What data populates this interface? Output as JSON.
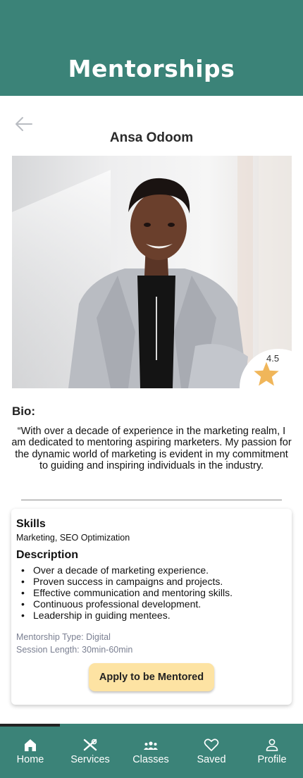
{
  "header": {
    "title": "Mentorships"
  },
  "mentor": {
    "name": "Ansa Odoom",
    "rating": "4.5"
  },
  "bio": {
    "title": "Bio:",
    "text": "“With over a decade of experience in the marketing realm, I am dedicated to mentoring aspiring marketers. My passion for the dynamic world of marketing is evident in my commitment to guiding and inspiring individuals in the industry."
  },
  "skills": {
    "title": "Skills",
    "text": "Marketing, SEO Optimization"
  },
  "description": {
    "title": "Description",
    "items": [
      "Over a decade of marketing experience.",
      "Proven success in campaigns and projects.",
      "Effective communication and mentoring skills.",
      "Continuous professional development.",
      "Leadership in guiding mentees."
    ]
  },
  "meta": {
    "type": "Mentorship Type: Digital",
    "length": "Session Length: 30min-60min"
  },
  "apply_button": "Apply to be Mentored",
  "nav": {
    "active": "Home",
    "items": [
      {
        "label": "Home",
        "icon": "home-icon"
      },
      {
        "label": "Services",
        "icon": "tools-icon"
      },
      {
        "label": "Classes",
        "icon": "group-icon"
      },
      {
        "label": "Saved",
        "icon": "heart-icon"
      },
      {
        "label": "Profile",
        "icon": "person-icon"
      }
    ]
  },
  "colors": {
    "brand": "#3b8378",
    "button": "#fde3a3",
    "star": "#f0b65a",
    "meta_text": "#7b8092"
  }
}
